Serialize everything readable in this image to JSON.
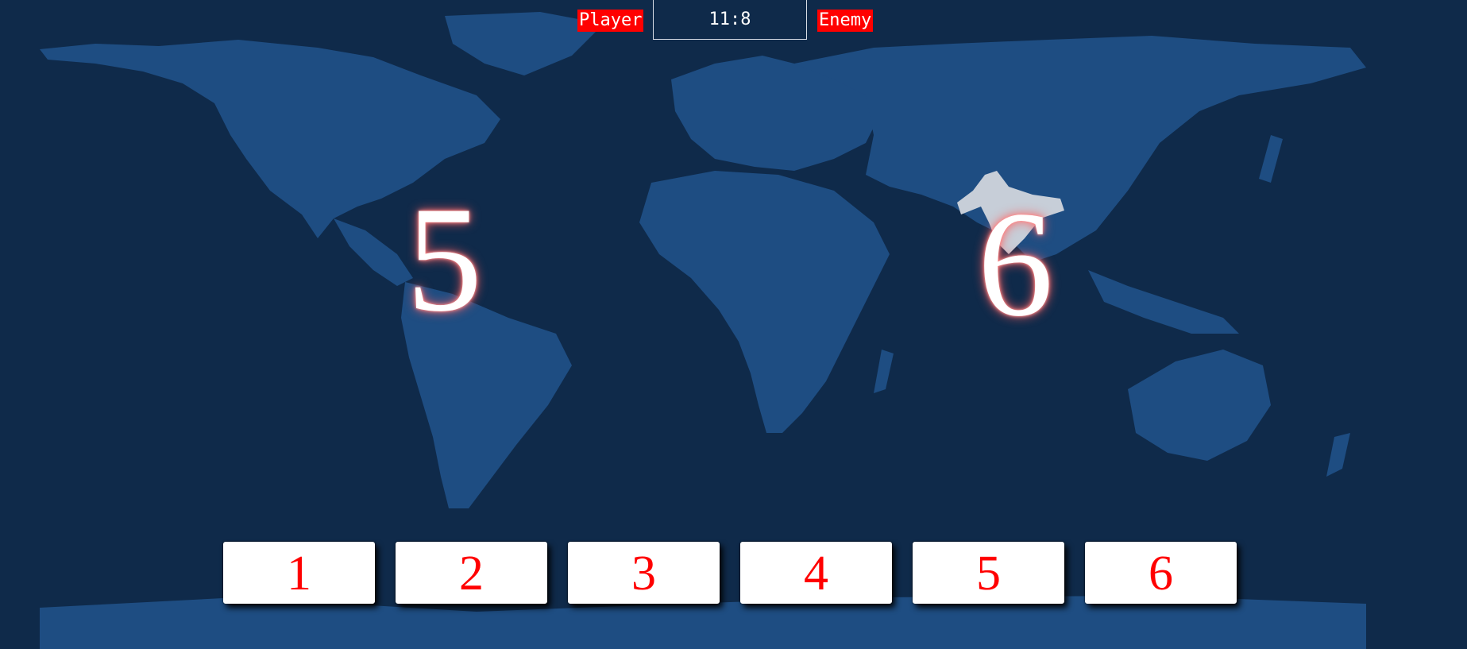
{
  "scoreboard": {
    "player_label": "Player",
    "enemy_label": "Enemy",
    "score": "11:8"
  },
  "board": {
    "player_number": "5",
    "enemy_number": "6",
    "highlighted_country": "India"
  },
  "choices": [
    {
      "label": "1"
    },
    {
      "label": "2"
    },
    {
      "label": "3"
    },
    {
      "label": "4"
    },
    {
      "label": "5"
    },
    {
      "label": "6"
    }
  ],
  "colors": {
    "background": "#0f2a4a",
    "land": "#1e4d82",
    "highlight": "#c7ced8",
    "accent_red": "#ff0000",
    "button_text": "#ff0000"
  }
}
